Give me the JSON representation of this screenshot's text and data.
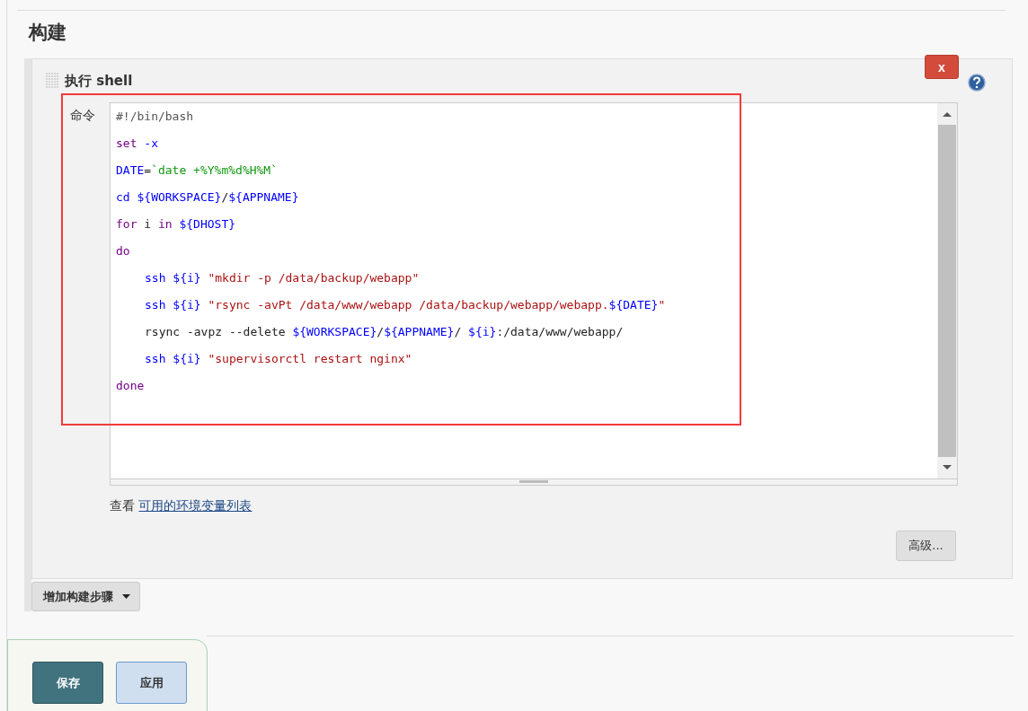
{
  "section": {
    "title": "构建"
  },
  "build_step": {
    "title": "执行 shell",
    "delete_label": "x",
    "field_label": "命令",
    "highlighted": true,
    "code_lines": [
      {
        "indented": false,
        "tokens": [
          {
            "kind": "comment",
            "text": "#!/bin/bash"
          }
        ]
      },
      {
        "indented": false,
        "tokens": [
          {
            "kind": "keyword",
            "text": "set "
          },
          {
            "kind": "builtin",
            "text": "-x"
          }
        ]
      },
      {
        "indented": false,
        "tokens": [
          {
            "kind": "builtin",
            "text": "DATE"
          },
          {
            "kind": "plain",
            "text": "="
          },
          {
            "kind": "backtick",
            "text": "`date +%Y%m%d%H%M`"
          }
        ]
      },
      {
        "indented": false,
        "tokens": [
          {
            "kind": "builtin",
            "text": "cd ${WORKSPACE}"
          },
          {
            "kind": "plain",
            "text": "/"
          },
          {
            "kind": "builtin",
            "text": "${APPNAME}"
          }
        ]
      },
      {
        "indented": false,
        "tokens": [
          {
            "kind": "keyword",
            "text": "for"
          },
          {
            "kind": "plain",
            "text": " i "
          },
          {
            "kind": "keyword",
            "text": "in "
          },
          {
            "kind": "builtin",
            "text": "${DHOST}"
          }
        ]
      },
      {
        "indented": false,
        "tokens": [
          {
            "kind": "keyword",
            "text": "do"
          }
        ]
      },
      {
        "indented": true,
        "tokens": [
          {
            "kind": "builtin",
            "text": "ssh ${i} "
          },
          {
            "kind": "string",
            "text": "\"mkdir -p /data/backup/webapp\""
          }
        ]
      },
      {
        "indented": true,
        "tokens": [
          {
            "kind": "builtin",
            "text": "ssh ${i} "
          },
          {
            "kind": "string",
            "text": "\"rsync -avPt /data/www/webapp /data/backup/webapp/webapp."
          },
          {
            "kind": "builtin",
            "text": "${DATE}"
          },
          {
            "kind": "string",
            "text": "\""
          }
        ]
      },
      {
        "indented": true,
        "tokens": [
          {
            "kind": "plain",
            "text": "rsync -avpz --delete "
          },
          {
            "kind": "builtin",
            "text": "${WORKSPACE}"
          },
          {
            "kind": "plain",
            "text": "/"
          },
          {
            "kind": "builtin",
            "text": "${APPNAME}"
          },
          {
            "kind": "plain",
            "text": "/ "
          },
          {
            "kind": "builtin",
            "text": "${i}"
          },
          {
            "kind": "plain",
            "text": ":/data/www/webapp/"
          }
        ]
      },
      {
        "indented": true,
        "tokens": [
          {
            "kind": "builtin",
            "text": "ssh ${i} "
          },
          {
            "kind": "string",
            "text": "\"supervisorctl restart nginx\""
          }
        ]
      },
      {
        "indented": false,
        "tokens": [
          {
            "kind": "keyword",
            "text": "done"
          }
        ]
      }
    ],
    "env_hint": "查看",
    "env_link": "可用的环境变量列表",
    "advanced_button": "高级..."
  },
  "add_step_button": "增加构建步骤",
  "footer": {
    "buttons": [
      {
        "kind": "primary",
        "label": "保存"
      },
      {
        "kind": "secondary",
        "label": "应用"
      }
    ]
  }
}
